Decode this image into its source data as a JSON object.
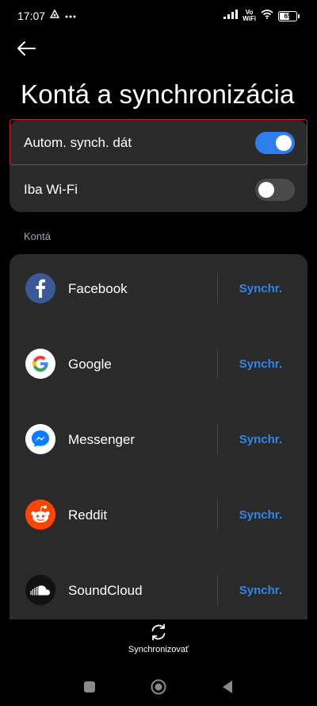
{
  "status_bar": {
    "time": "17:07",
    "icons": [
      "alarm-icon",
      "more-dots-icon",
      "signal-icon",
      "volte-icon",
      "wifi-icon",
      "battery-icon"
    ],
    "volte_line1": "Vo",
    "volte_line2": "WiFi",
    "battery_level": "65"
  },
  "header": {
    "back_icon": "arrow-left-icon",
    "title": "Kontá a synchronizácia"
  },
  "settings": {
    "auto_sync_label": "Autom. synch. dát",
    "auto_sync_on": true,
    "wifi_only_label": "Iba Wi-Fi",
    "wifi_only_on": false
  },
  "accounts_section": {
    "label": "Kontá",
    "sync_label": "Synchr.",
    "items": [
      {
        "name": "Facebook",
        "icon": "facebook-icon"
      },
      {
        "name": "Google",
        "icon": "google-icon"
      },
      {
        "name": "Messenger",
        "icon": "messenger-icon"
      },
      {
        "name": "Reddit",
        "icon": "reddit-icon"
      },
      {
        "name": "SoundCloud",
        "icon": "soundcloud-icon"
      }
    ]
  },
  "bottom_action": {
    "label": "Synchronizovať",
    "icon": "sync-icon"
  },
  "nav": {
    "icons": [
      "recents-icon",
      "home-icon",
      "back-icon"
    ]
  },
  "colors": {
    "accent": "#2f7ef0",
    "sync_link": "#2f86e8",
    "card_bg": "#2a2a2a",
    "background": "#000000",
    "highlight_border": "#c62828"
  }
}
